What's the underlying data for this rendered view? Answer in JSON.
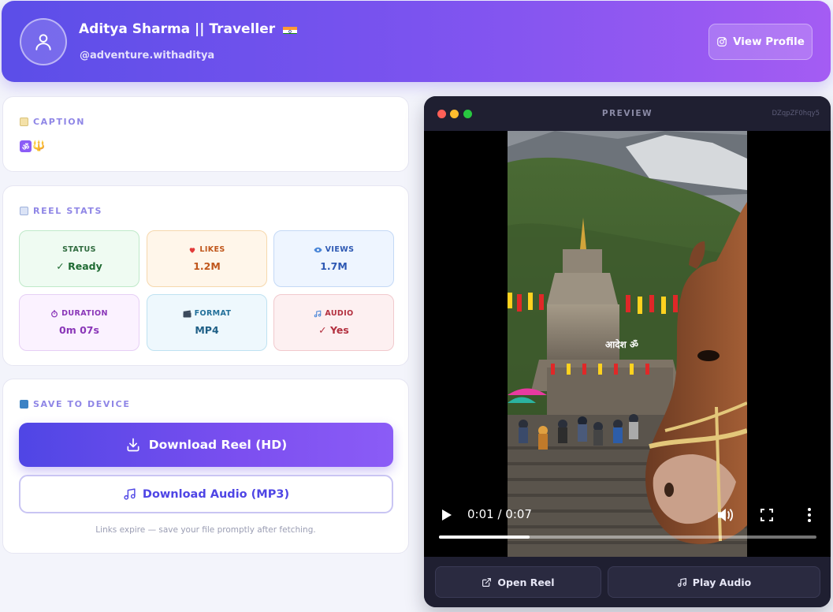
{
  "header": {
    "name": "Aditya Sharma || Traveller",
    "handle": "@adventure.withaditya",
    "view_profile_label": "View Profile"
  },
  "caption": {
    "title": "CAPTION",
    "emoji_1": "ॐ",
    "emoji_2": "🔱"
  },
  "stats": {
    "title": "REEL STATS",
    "items": [
      {
        "label": "STATUS",
        "value": "✓ Ready"
      },
      {
        "label": "LIKES",
        "value": "1.2M"
      },
      {
        "label": "VIEWS",
        "value": "1.7M"
      },
      {
        "label": "DURATION",
        "value": "0m 07s"
      },
      {
        "label": "FORMAT",
        "value": "MP4"
      },
      {
        "label": "AUDIO",
        "value": "✓ Yes"
      }
    ]
  },
  "save": {
    "title": "SAVE TO DEVICE",
    "download_reel_label": "Download Reel (HD)",
    "download_audio_label": "Download Audio (MP3)",
    "note": "Links expire — save your file promptly after fetching."
  },
  "preview": {
    "title": "PREVIEW",
    "reel_id": "DZqpZF0hqy5",
    "overlay_text": "आदेश ॐ",
    "time": "0:01 / 0:07",
    "progress": 0.24,
    "open_reel_label": "Open Reel",
    "play_audio_label": "Play Audio"
  },
  "colors": {
    "accent": "#4f46e5",
    "accent_2": "#8b5cf6"
  }
}
